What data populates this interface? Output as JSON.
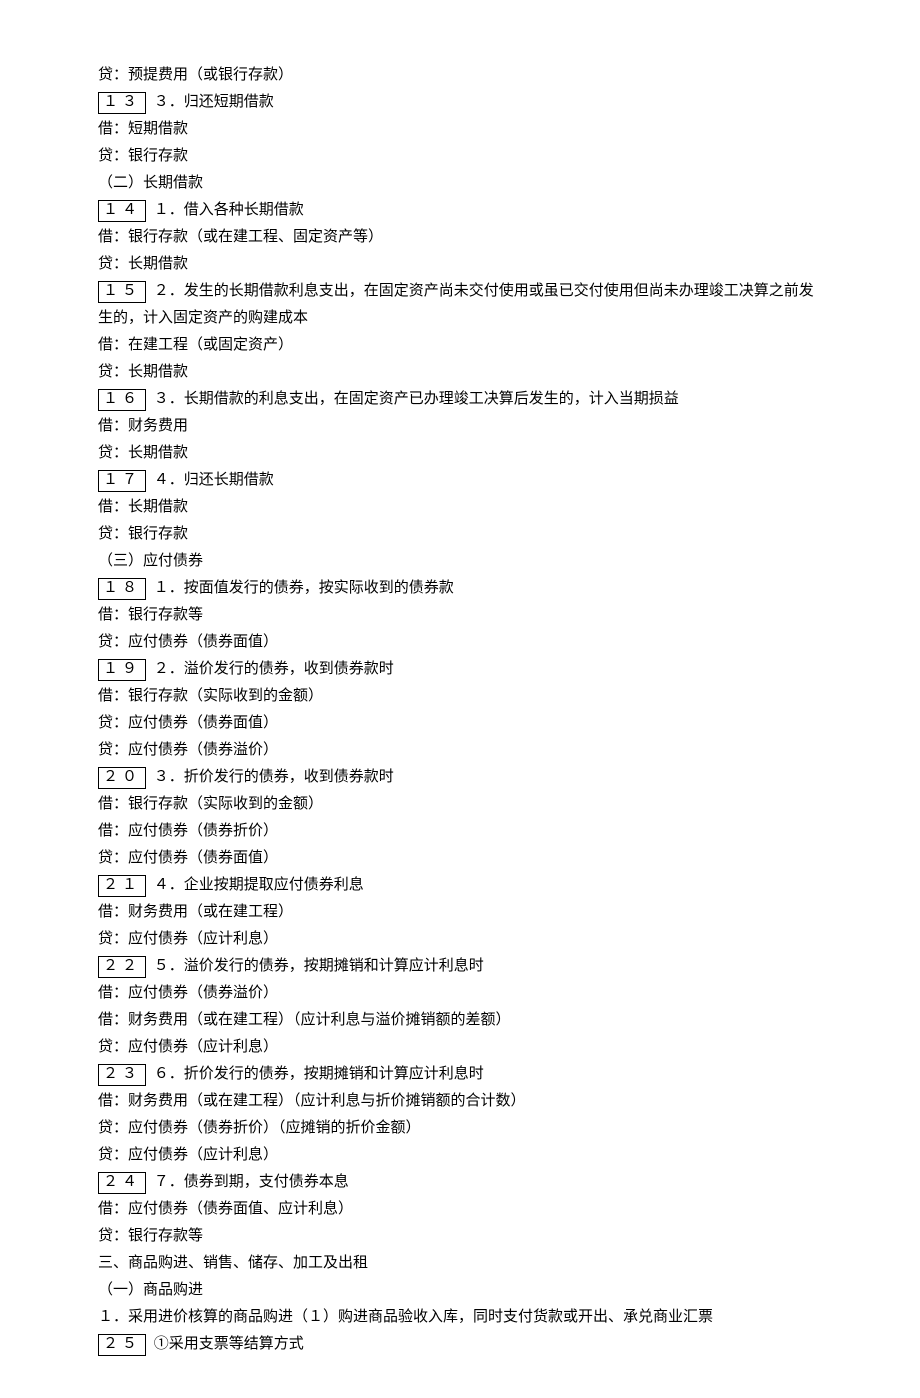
{
  "lines": [
    {
      "box": null,
      "text": "贷：预提费用（或银行存款）"
    },
    {
      "box": "１３",
      "text": "３．归还短期借款"
    },
    {
      "box": null,
      "text": "借：短期借款"
    },
    {
      "box": null,
      "text": "贷：银行存款"
    },
    {
      "box": null,
      "text": "（二）长期借款"
    },
    {
      "box": "１４",
      "text": "１．借入各种长期借款"
    },
    {
      "box": null,
      "text": "借：银行存款（或在建工程、固定资产等）"
    },
    {
      "box": null,
      "text": "贷：长期借款"
    },
    {
      "box": "１５",
      "text": "２．发生的长期借款利息支出，在固定资产尚未交付使用或虽已交付使用但尚未办理竣工决算之前发生的，计入固定资产的购建成本"
    },
    {
      "box": null,
      "text": "借：在建工程（或固定资产）"
    },
    {
      "box": null,
      "text": "贷：长期借款"
    },
    {
      "box": "１６",
      "text": "３．长期借款的利息支出，在固定资产已办理竣工决算后发生的，计入当期损益"
    },
    {
      "box": null,
      "text": "借：财务费用"
    },
    {
      "box": null,
      "text": "贷：长期借款"
    },
    {
      "box": "１７",
      "text": "４．归还长期借款"
    },
    {
      "box": null,
      "text": "借：长期借款"
    },
    {
      "box": null,
      "text": "贷：银行存款"
    },
    {
      "box": null,
      "text": "（三）应付债券"
    },
    {
      "box": "１８",
      "text": "１．按面值发行的债券，按实际收到的债券款"
    },
    {
      "box": null,
      "text": "借：银行存款等"
    },
    {
      "box": null,
      "text": "贷：应付债券（债券面值）"
    },
    {
      "box": "１９",
      "text": "２．溢价发行的债券，收到债券款时"
    },
    {
      "box": null,
      "text": "借：银行存款（实际收到的金额）"
    },
    {
      "box": null,
      "text": "贷：应付债券（债券面值）"
    },
    {
      "box": null,
      "text": "贷：应付债券（债券溢价）"
    },
    {
      "box": "２０",
      "text": "３．折价发行的债券，收到债券款时"
    },
    {
      "box": null,
      "text": "借：银行存款（实际收到的金额）"
    },
    {
      "box": null,
      "text": "借：应付债券（债券折价）"
    },
    {
      "box": null,
      "text": "贷：应付债券（债券面值）"
    },
    {
      "box": "２１",
      "text": "４．企业按期提取应付债券利息"
    },
    {
      "box": null,
      "text": "借：财务费用（或在建工程）"
    },
    {
      "box": null,
      "text": "贷：应付债券（应计利息）"
    },
    {
      "box": "２２",
      "text": "５．溢价发行的债券，按期摊销和计算应计利息时"
    },
    {
      "box": null,
      "text": "借：应付债券（债券溢价）"
    },
    {
      "box": null,
      "text": "借：财务费用（或在建工程）（应计利息与溢价摊销额的差额）"
    },
    {
      "box": null,
      "text": "贷：应付债券（应计利息）"
    },
    {
      "box": "２３",
      "text": "６．折价发行的债券，按期摊销和计算应计利息时"
    },
    {
      "box": null,
      "text": "借：财务费用（或在建工程）（应计利息与折价摊销额的合计数）"
    },
    {
      "box": null,
      "text": "贷：应付债券（债券折价）（应摊销的折价金额）"
    },
    {
      "box": null,
      "text": "贷：应付债券（应计利息）"
    },
    {
      "box": "２４",
      "text": "７．债券到期，支付债券本息"
    },
    {
      "box": null,
      "text": "借：应付债券（债券面值、应计利息）"
    },
    {
      "box": null,
      "text": "贷：银行存款等"
    },
    {
      "box": null,
      "text": "三、商品购进、销售、储存、加工及出租"
    },
    {
      "box": null,
      "text": "（一）商品购进"
    },
    {
      "box": null,
      "text": "１．采用进价核算的商品购进（１）购进商品验收入库，同时支付货款或开出、承兑商业汇票"
    },
    {
      "box": "２５",
      "text": "①采用支票等结算方式"
    }
  ]
}
